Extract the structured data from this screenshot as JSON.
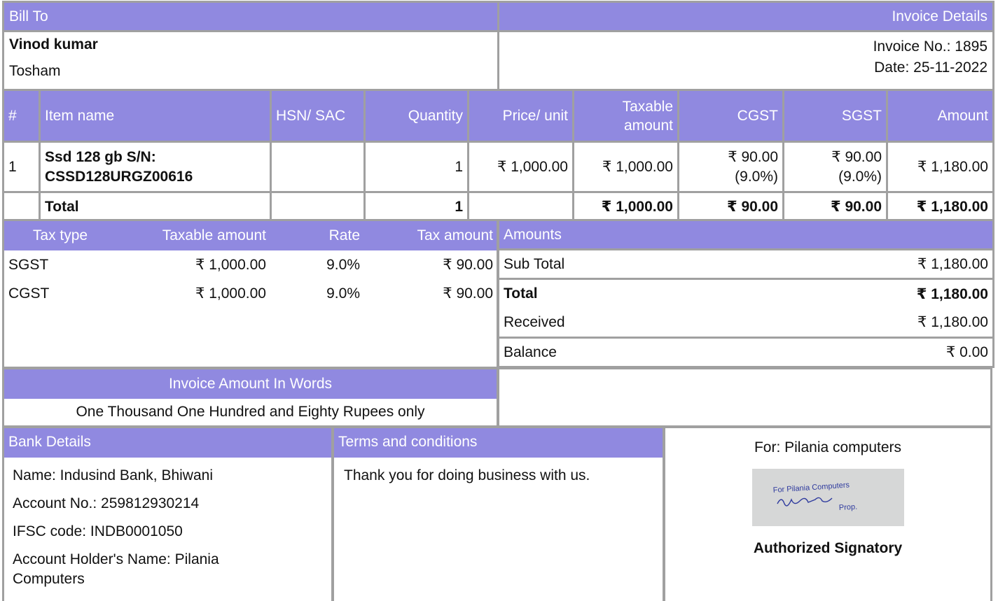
{
  "bill_to": {
    "header": "Bill To",
    "name": "Vinod kumar",
    "address": "Tosham"
  },
  "invoice_details": {
    "header": "Invoice Details",
    "number": "Invoice No.: 1895",
    "date": "Date: 25-11-2022"
  },
  "items": {
    "columns": [
      "#",
      "Item name",
      "HSN/ SAC",
      "Quantity",
      "Price/ unit",
      "Taxable amount",
      "CGST",
      "SGST",
      "Amount"
    ],
    "rows": [
      {
        "num": "1",
        "name": "Ssd 128 gb S/N: CSSD128URGZ00616",
        "hsn": "",
        "qty": "1",
        "price": "₹ 1,000.00",
        "taxable": "₹ 1,000.00",
        "cgst": "₹ 90.00",
        "cgst_rate": "(9.0%)",
        "sgst": "₹ 90.00",
        "sgst_rate": "(9.0%)",
        "amount": "₹ 1,180.00"
      }
    ],
    "total": {
      "label": "Total",
      "qty": "1",
      "taxable": "₹ 1,000.00",
      "cgst": "₹ 90.00",
      "sgst": "₹ 90.00",
      "amount": "₹ 1,180.00"
    }
  },
  "tax_summary": {
    "columns": [
      "Tax type",
      "Taxable amount",
      "Rate",
      "Tax amount"
    ],
    "rows": [
      {
        "type": "SGST",
        "taxable": "₹ 1,000.00",
        "rate": "9.0%",
        "tax": "₹ 90.00"
      },
      {
        "type": "CGST",
        "taxable": "₹ 1,000.00",
        "rate": "9.0%",
        "tax": "₹ 90.00"
      }
    ]
  },
  "amounts": {
    "header": "Amounts",
    "sub_total": {
      "label": "Sub Total",
      "value": "₹ 1,180.00"
    },
    "total": {
      "label": "Total",
      "value": "₹ 1,180.00"
    },
    "received": {
      "label": "Received",
      "value": "₹ 1,180.00"
    },
    "balance": {
      "label": "Balance",
      "value": "₹ 0.00"
    }
  },
  "words": {
    "header": "Invoice Amount In Words",
    "value": "One Thousand One Hundred and Eighty Rupees only"
  },
  "bank": {
    "header": "Bank Details",
    "name": "Name: Indusind Bank, Bhiwani",
    "account": "Account No.: 259812930214",
    "ifsc": "IFSC code: INDB0001050",
    "holder": "Account Holder's Name: Pilania Computers"
  },
  "terms": {
    "header": "Terms and conditions",
    "text": "Thank you for doing business with us."
  },
  "signature": {
    "for": "For: Pilania computers",
    "stamp_line1": "For Pilania Computers",
    "stamp_line2": "Prop.",
    "authorized": "Authorized Signatory"
  },
  "colors": {
    "header_bg": "#9089e0",
    "border": "#a0a0a0",
    "stamp_ink": "#2f3b9e"
  }
}
